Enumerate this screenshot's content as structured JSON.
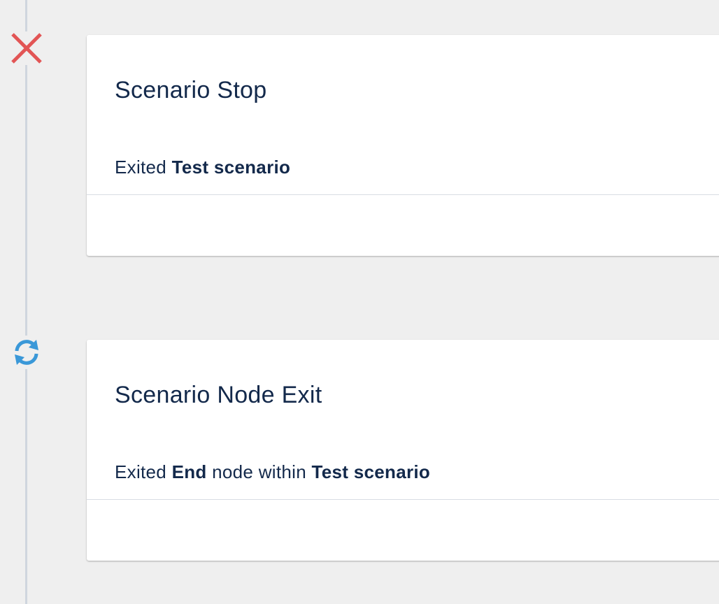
{
  "timeline": {
    "events": [
      {
        "icon": "close-icon",
        "icon_color": "#e25555",
        "title": "Scenario Stop",
        "description": {
          "prefix": "Exited ",
          "scenario": "Test scenario"
        }
      },
      {
        "icon": "sync-icon",
        "icon_color": "#3a98d8",
        "title": "Scenario Node Exit",
        "description": {
          "prefix": "Exited ",
          "node": "End",
          "middle": " node within ",
          "scenario": "Test scenario"
        }
      }
    ]
  },
  "colors": {
    "background": "#efefef",
    "card": "#ffffff",
    "text": "#13294b",
    "timeline_line": "#cfd6de"
  }
}
